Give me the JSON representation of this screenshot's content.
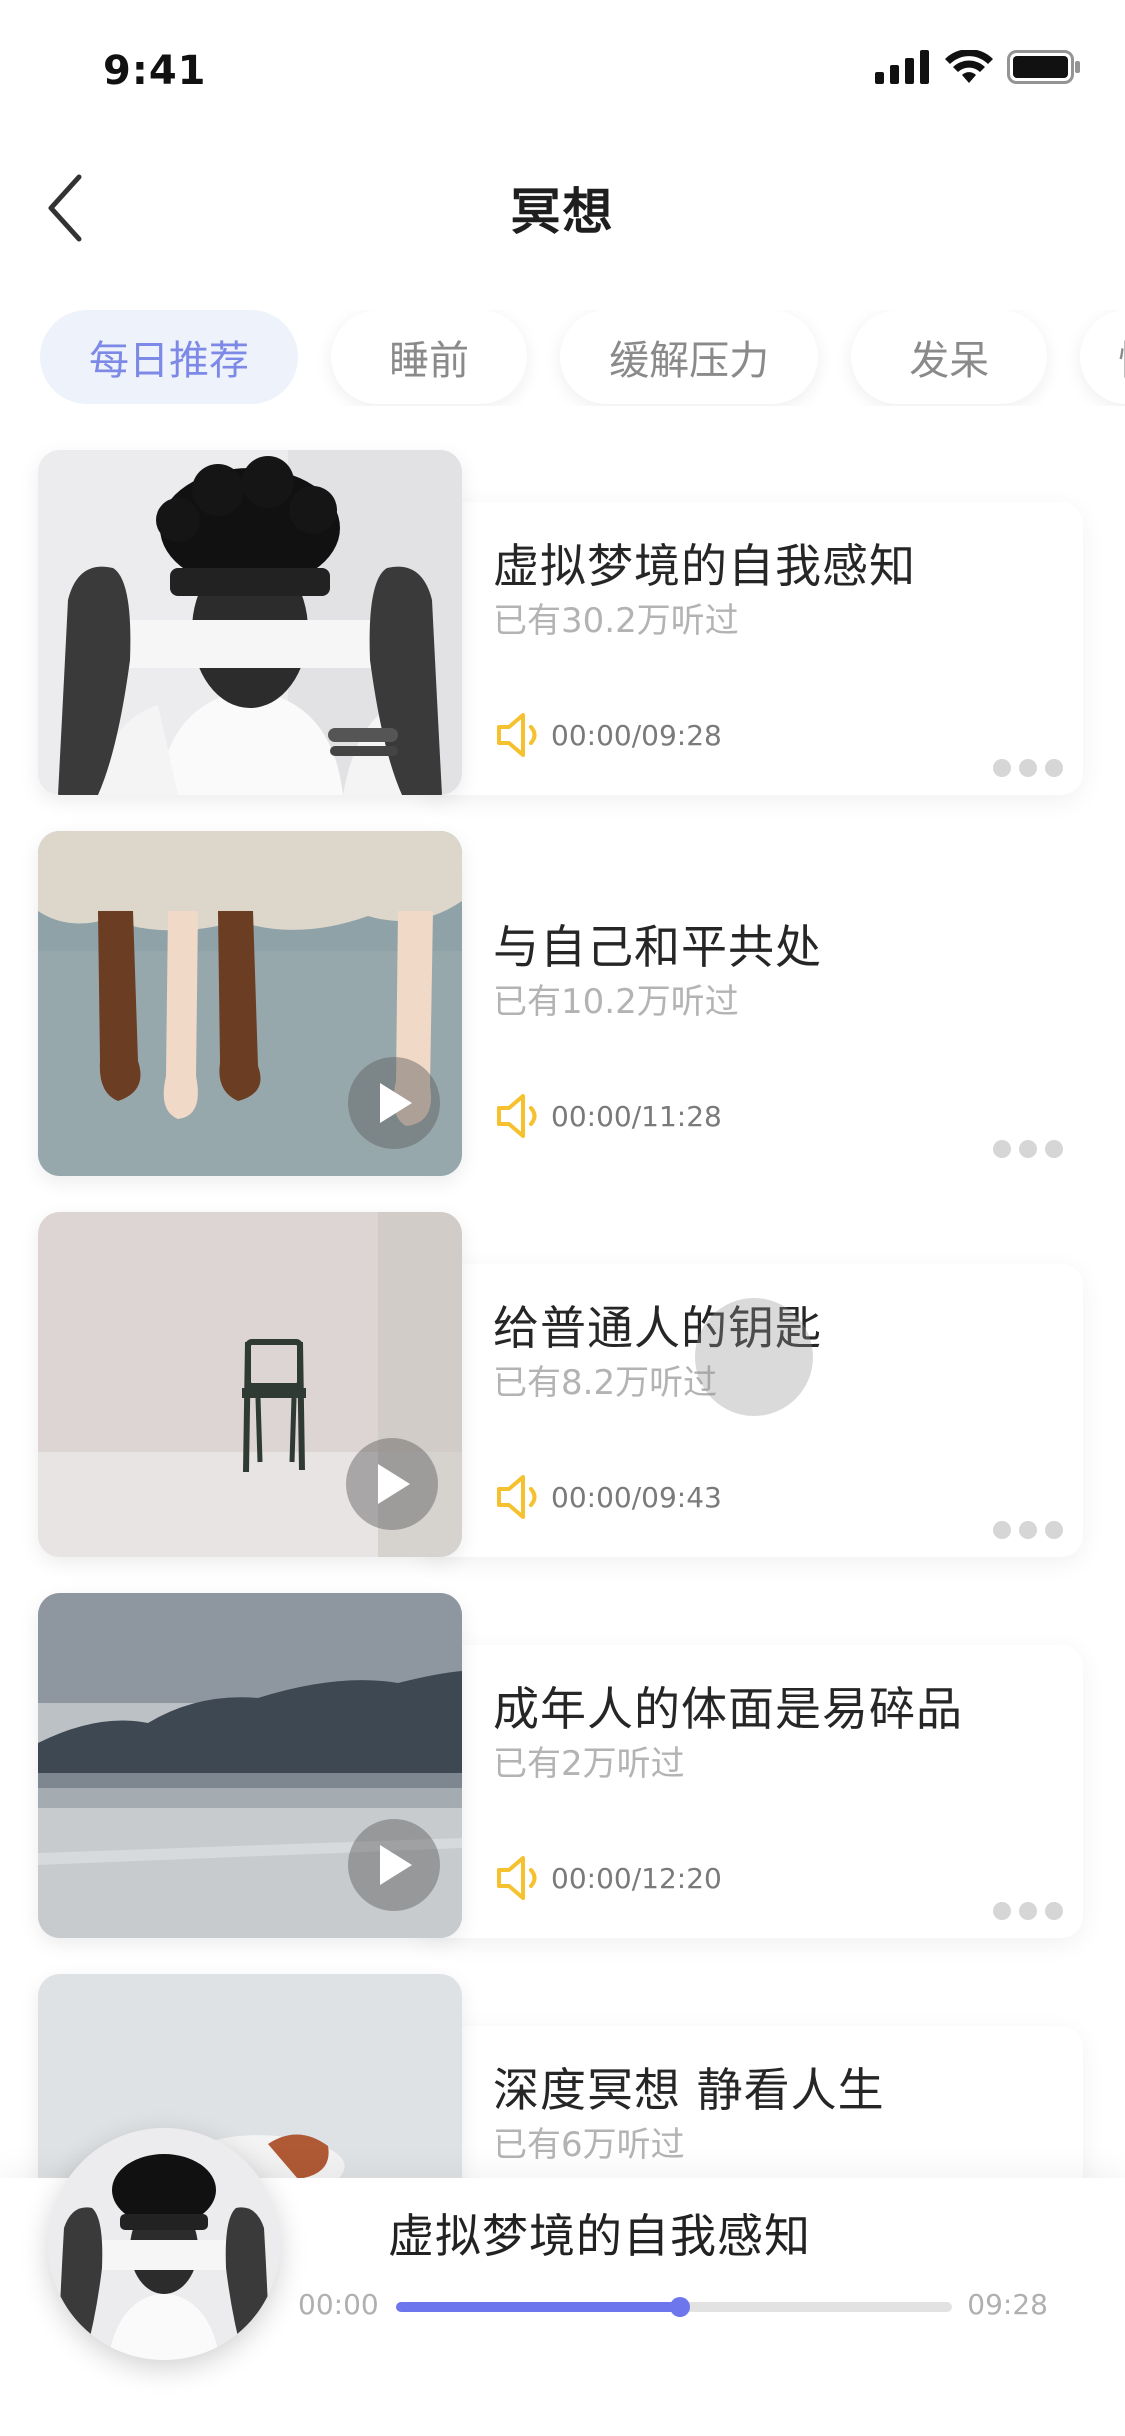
{
  "status_bar": {
    "time": "9:41"
  },
  "nav": {
    "title": "冥想"
  },
  "tabs": [
    {
      "label": "每日推荐",
      "active": true
    },
    {
      "label": "睡前",
      "active": false
    },
    {
      "label": "缓解压力",
      "active": false
    },
    {
      "label": "发呆",
      "active": false
    },
    {
      "label": "情",
      "active": false
    }
  ],
  "items": [
    {
      "title": "虚拟梦境的自我感知",
      "listens": "已有30.2万听过",
      "time": "00:00/09:28",
      "image": "blindfold-portrait"
    },
    {
      "title": "与自己和平共处",
      "listens": "已有10.2万听过",
      "time": "00:00/11:28",
      "image": "feet-under-blanket"
    },
    {
      "title": "给普通人的钥匙",
      "listens": "已有8.2万听过",
      "time": "00:00/09:43",
      "image": "empty-chair"
    },
    {
      "title": "成年人的体面是易碎品",
      "listens": "已有2万听过",
      "time": "00:00/12:20",
      "image": "frozen-lake"
    },
    {
      "title": "深度冥想 静看人生",
      "listens": "已有6万听过",
      "time": "",
      "image": "lying-woman"
    }
  ],
  "player": {
    "title": "虚拟梦境的自我感知",
    "current": "00:00",
    "duration": "09:28",
    "progress": 0.51
  },
  "colors": {
    "accent": "#6e76ee",
    "tab_active_bg": "#eef2fb",
    "tab_active_text": "#7d89e6",
    "speaker": "#f5c12e"
  }
}
